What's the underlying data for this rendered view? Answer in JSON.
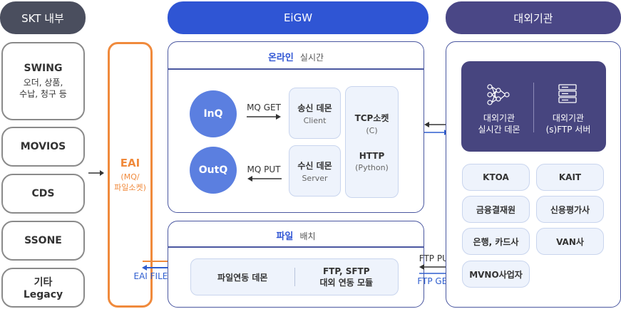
{
  "headers": {
    "left": "SKT 내부",
    "center": "EiGW",
    "right": "대외기관"
  },
  "colors": {
    "header_dark": "#4a4e5e",
    "header_blue": "#2f55d4",
    "header_purple": "#4a4786",
    "accent_orange": "#f08a3c",
    "accent_blue": "#2f5ecf",
    "circle_blue": "#5b7fe0",
    "dark_box": "#47457f"
  },
  "internal_systems": [
    {
      "title": "SWING",
      "sub1": "오더, 상품,",
      "sub2": "수납, 청구 등"
    },
    {
      "title": "MOVIOS"
    },
    {
      "title": "CDS"
    },
    {
      "title": "SSONE"
    },
    {
      "title": "기타",
      "title2": "Legacy"
    }
  ],
  "eai": {
    "title": "EAI",
    "sub1": "(MQ/",
    "sub2": "파일소켓)"
  },
  "online": {
    "title_main": "온라인",
    "title_sub": "실시간",
    "inq": "InQ",
    "outq": "OutQ",
    "mq_get": "MQ GET",
    "mq_put": "MQ PUT",
    "send_daemon": "송신 데몬",
    "send_sub": "Client",
    "recv_daemon": "수신 데몬",
    "recv_sub": "Server",
    "tcp": "TCP소켓",
    "tcp_sub": "(C)",
    "http": "HTTP",
    "http_sub": "(Python)"
  },
  "batch": {
    "title_main": "파일",
    "title_sub": "배치",
    "daemon": "파일연동 데몬",
    "module1": "FTP, SFTP",
    "module2": "대외 연동 모듈"
  },
  "eai_file_put": "EAI FILE PUT",
  "ftp_put": "FTP PUT",
  "ftp_get": "FTP GET",
  "external_top": {
    "left1": "대외기관",
    "left2": "실시간 데몬",
    "right1": "대외기관",
    "right2": "(s)FTP 서버",
    "left_icon": "network-icon",
    "right_icon": "server-icon"
  },
  "external_orgs": [
    "KTOA",
    "KAIT",
    "금융결재원",
    "신용평가사",
    "은행, 카드사",
    "VAN사",
    "MVNO사업자"
  ]
}
